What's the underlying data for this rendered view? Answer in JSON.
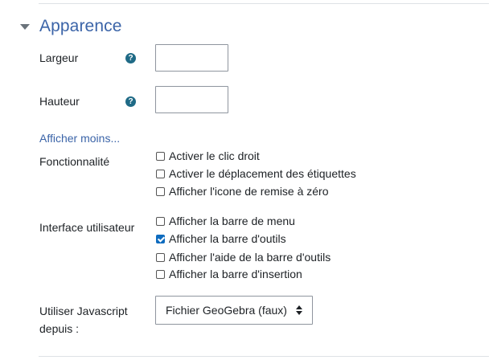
{
  "section": {
    "title": "Apparence",
    "icon": "caret-down-icon"
  },
  "fields": {
    "width": {
      "label": "Largeur",
      "value": "",
      "help_icon": "question-circle-icon"
    },
    "height": {
      "label": "Hauteur",
      "value": "",
      "help_icon": "question-circle-icon"
    }
  },
  "show_less_link": "Afficher moins...",
  "functionality": {
    "label": "Fonctionnalité",
    "options": [
      {
        "label": "Activer le clic droit",
        "checked": false
      },
      {
        "label": "Activer le déplacement des étiquettes",
        "checked": false
      },
      {
        "label": "Afficher l'icone de remise à zéro",
        "checked": false
      }
    ]
  },
  "user_interface": {
    "label": "Interface utilisateur",
    "options": [
      {
        "label": "Afficher la barre de menu",
        "checked": false
      },
      {
        "label": "Afficher la barre d'outils",
        "checked": true
      },
      {
        "label": "Afficher l'aide de la barre d'outils",
        "checked": false
      },
      {
        "label": "Afficher la barre d'insertion",
        "checked": false
      }
    ]
  },
  "javascript_source": {
    "label_line1": "Utiliser Javascript",
    "label_line2": "depuis :",
    "selected": "Fichier GeoGebra (faux)"
  },
  "colors": {
    "accent": "#3b64a8",
    "help_icon": "#1f6a86",
    "checkbox_checked": "#0f6cbf"
  }
}
